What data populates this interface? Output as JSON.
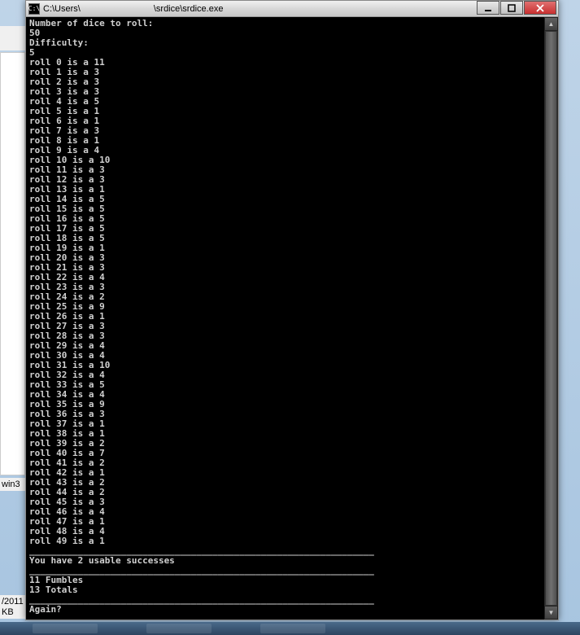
{
  "window": {
    "icon_label": "C:\\",
    "title_left": "C:\\Users\\",
    "title_mid": "\\srdice\\srdice.exe"
  },
  "background": {
    "frag3": "win3",
    "frag4": "/2011",
    "frag5": "KB"
  },
  "console": {
    "prompt_dice": "Number of dice to roll:",
    "dice_count": "50",
    "prompt_diff": "Difficulty:",
    "difficulty": "5",
    "rolls": [
      "roll 0 is a 11",
      "roll 1 is a 3",
      "roll 2 is a 3",
      "roll 3 is a 3",
      "roll 4 is a 5",
      "roll 5 is a 1",
      "roll 6 is a 1",
      "roll 7 is a 3",
      "roll 8 is a 1",
      "roll 9 is a 4",
      "roll 10 is a 10",
      "roll 11 is a 3",
      "roll 12 is a 3",
      "roll 13 is a 1",
      "roll 14 is a 5",
      "roll 15 is a 5",
      "roll 16 is a 5",
      "roll 17 is a 5",
      "roll 18 is a 5",
      "roll 19 is a 1",
      "roll 20 is a 3",
      "roll 21 is a 3",
      "roll 22 is a 4",
      "roll 23 is a 3",
      "roll 24 is a 2",
      "roll 25 is a 9",
      "roll 26 is a 1",
      "roll 27 is a 3",
      "roll 28 is a 3",
      "roll 29 is a 4",
      "roll 30 is a 4",
      "roll 31 is a 10",
      "roll 32 is a 4",
      "roll 33 is a 5",
      "roll 34 is a 4",
      "roll 35 is a 9",
      "roll 36 is a 3",
      "roll 37 is a 1",
      "roll 38 is a 1",
      "roll 39 is a 2",
      "roll 40 is a 7",
      "roll 41 is a 2",
      "roll 42 is a 1",
      "roll 43 is a 2",
      "roll 44 is a 2",
      "roll 45 is a 3",
      "roll 46 is a 4",
      "roll 47 is a 1",
      "roll 48 is a 4",
      "roll 49 is a 1"
    ],
    "divider": "________________________________________________________________",
    "success_line": "You have 2 usable successes",
    "fumbles": "11 Fumbles",
    "totals": "13 Totals",
    "again": "Again?",
    "cursor": "_"
  },
  "scroll": {
    "up": "▲",
    "down": "▼"
  }
}
